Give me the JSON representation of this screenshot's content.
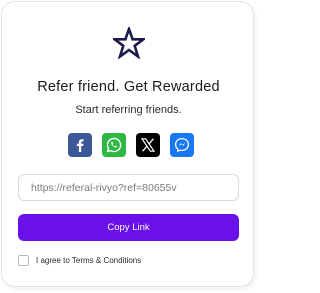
{
  "header": {
    "logo_icon": "star-outline-icon",
    "title": "Refer friend. Get Rewarded",
    "subtitle": "Start referring friends."
  },
  "share": {
    "items": [
      {
        "icon": "facebook-icon",
        "color": "#3b5998"
      },
      {
        "icon": "whatsapp-icon",
        "color": "#2db843"
      },
      {
        "icon": "x-icon",
        "color": "#000000"
      },
      {
        "icon": "messenger-icon",
        "color": "#1877f2"
      }
    ]
  },
  "referral": {
    "link_value": "https://referal-rivyo?ref=80655v",
    "copy_label": "Copy Link"
  },
  "terms": {
    "checked": false,
    "label": "I agree to Terms & Conditions"
  },
  "colors": {
    "accent": "#6a10e8",
    "logo": "#1c1a4a"
  }
}
